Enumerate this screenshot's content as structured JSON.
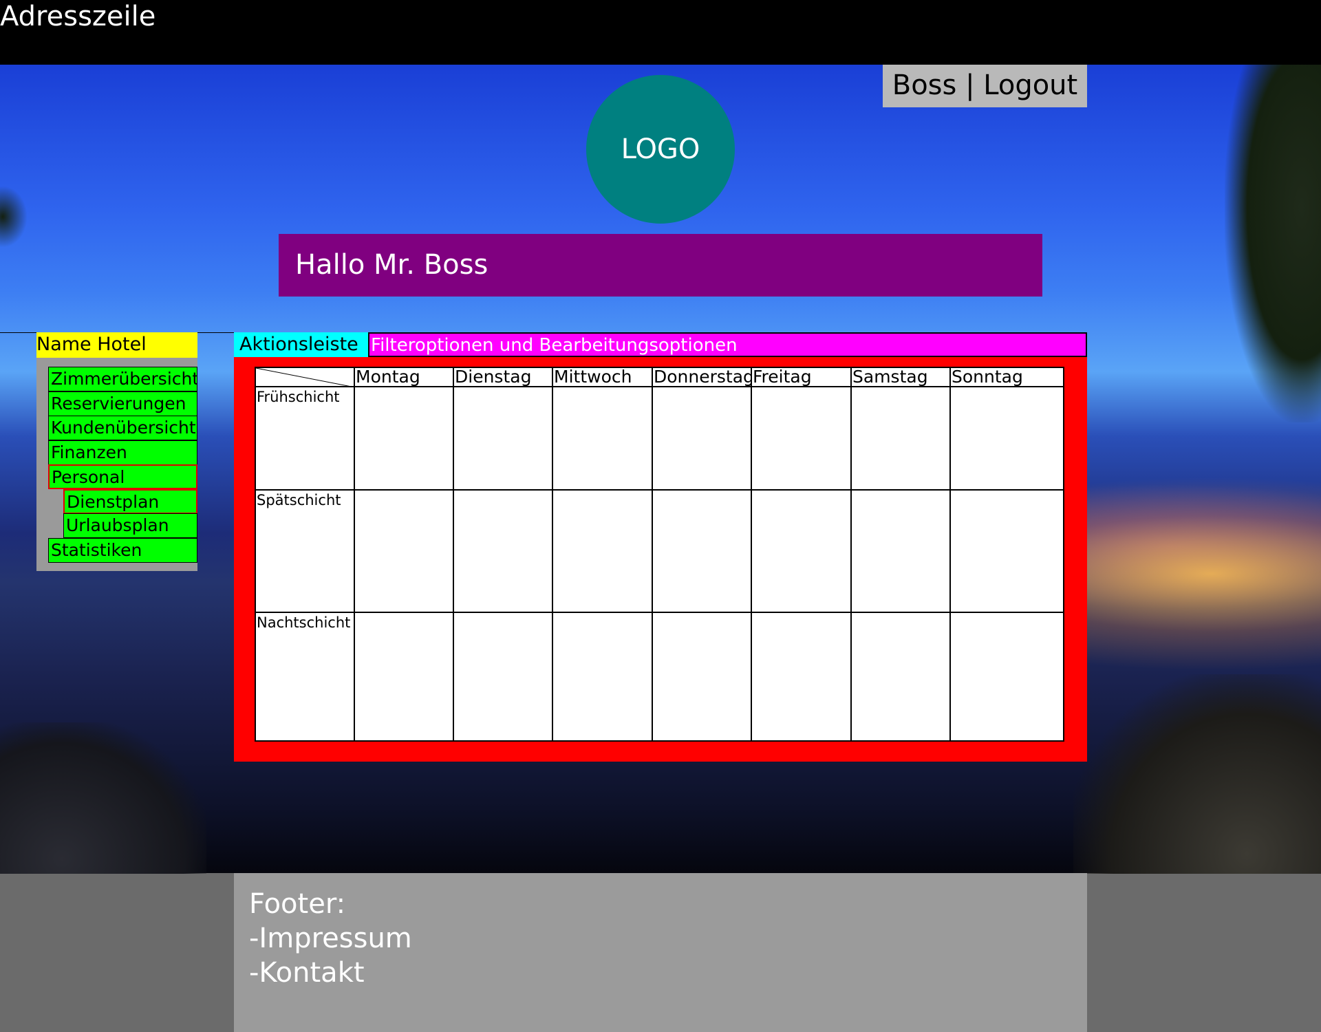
{
  "browser": {
    "address_label": "Adresszeile"
  },
  "header": {
    "user_links": "Boss | Logout",
    "logo_text": "LOGO",
    "greeting": "Hallo Mr. Boss"
  },
  "sidebar": {
    "title": "Name Hotel",
    "items": [
      {
        "label": "Zimmerübersicht"
      },
      {
        "label": "Reservierungen"
      },
      {
        "label": "Kundenübersicht"
      },
      {
        "label": "Finanzen"
      },
      {
        "label": "Personal"
      },
      {
        "label": "Dienstplan"
      },
      {
        "label": "Urlaubsplan"
      },
      {
        "label": "Statistiken"
      }
    ]
  },
  "main": {
    "action_bar_label": "Aktionsleiste",
    "filter_bar_label": "Filteroptionen und Bearbeitungsoptionen",
    "schedule": {
      "days": [
        "Montag",
        "Dienstag",
        "Mittwoch",
        "Donnerstag",
        "Freitag",
        "Samstag",
        "Sonntag"
      ],
      "shifts": [
        "Frühschicht",
        "Spätschicht",
        "Nachtschicht"
      ]
    }
  },
  "footer": {
    "heading": "Footer:",
    "links": [
      "-Impressum",
      "-Kontakt"
    ]
  },
  "colors": {
    "action_bar": "#00ffff",
    "filter_bar": "#ff00ff",
    "greeting_bar": "#800080",
    "logo": "#008080",
    "nav_item": "#00ff00",
    "hotel_name": "#ffff00",
    "schedule_frame": "#ff0000"
  }
}
